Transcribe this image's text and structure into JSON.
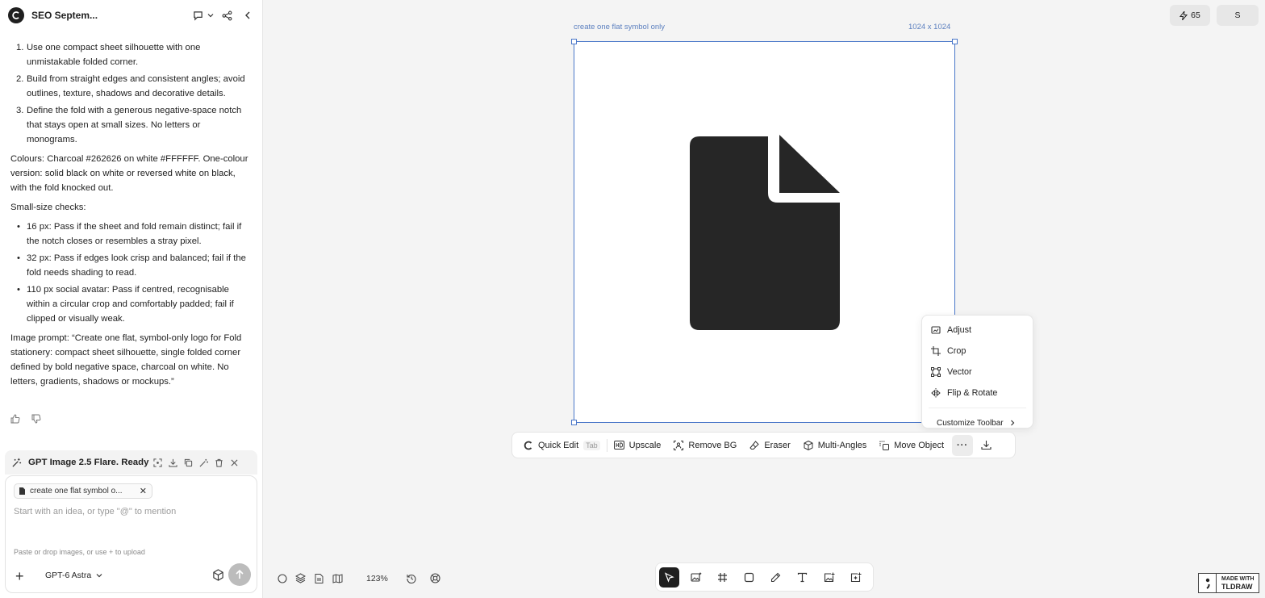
{
  "sidebar": {
    "title": "SEO Septem...",
    "numbered_list": [
      {
        "num": "1.",
        "text": "Use one compact sheet silhouette with one unmistakable folded corner."
      },
      {
        "num": "2.",
        "text": "Build from straight edges and consistent angles; avoid outlines, texture, shadows and decorative details."
      },
      {
        "num": "3.",
        "text": "Define the fold with a generous negative-space notch that stays open at small sizes. No letters or monograms."
      }
    ],
    "colours": "Colours: Charcoal #262626 on white #FFFFFF. One-colour version: solid black on white or reversed white on black, with the fold knocked out.",
    "checks_heading": "Small-size checks:",
    "checks": [
      {
        "text": "16 px: Pass if the sheet and fold remain distinct; fail if the notch closes or resembles a stray pixel."
      },
      {
        "text": "32 px: Pass if edges look crisp and balanced; fail if the fold needs shading to read."
      },
      {
        "text": "110 px social avatar: Pass if centred, recognisable within a circular crop and comfortably padded; fail if clipped or visually weak."
      }
    ],
    "image_prompt": "Image prompt: “Create one flat, symbol-only logo for Fold stationery: compact sheet silhouette, single folded corner defined by bold negative space, charcoal on white. No letters, gradients, shadows or mockups.”",
    "generation_label": "GPT Image 2.5 Flare. Ready ...",
    "chip_label": "create one flat symbol o...",
    "input_placeholder": "Start with an idea, or type \"@\" to mention",
    "upload_hint": "Paste or drop images, or use + to upload",
    "model_name": "GPT-6 Astra"
  },
  "canvas": {
    "frame_label": "create one flat symbol only",
    "frame_size": "1024 x 1024",
    "credits": "65",
    "user_initial": "S",
    "zoom": "123%",
    "symbol_color": "#262626",
    "selection_color": "#4a77c9"
  },
  "image_toolbar": {
    "quick_edit": "Quick Edit",
    "quick_edit_key": "Tab",
    "upscale": "Upscale",
    "remove_bg": "Remove BG",
    "eraser": "Eraser",
    "multi_angles": "Multi-Angles",
    "move_object": "Move Object",
    "more": "···"
  },
  "menu": {
    "items": [
      "Adjust",
      "Crop",
      "Vector",
      "Flip & Rotate"
    ],
    "customize": "Customize Toolbar"
  },
  "badge": {
    "line1": "MADE WITH",
    "line2": "TLDRAW"
  }
}
